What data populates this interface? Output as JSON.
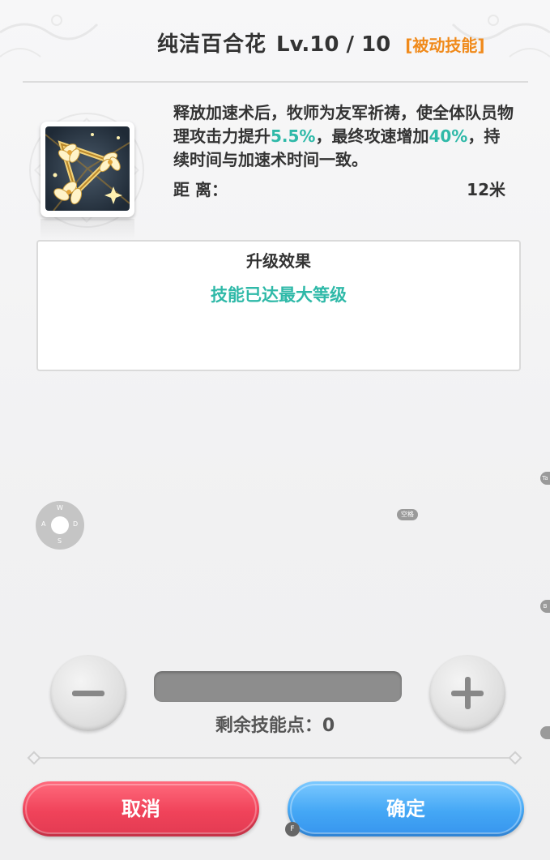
{
  "skill": {
    "name": "纯洁百合花",
    "level": "Lv.10 / 10",
    "type": "[被动技能]",
    "description_parts": {
      "p1": "释放加速术后，牧师为友军祈祷，使全体队员物理攻击力提升",
      "h1": "5.5%",
      "p2": "，最终攻速增加",
      "h2": "40%",
      "p3": "，持续时间与加速术时间一致。"
    },
    "range_label": "距 离：",
    "range_value": "12米",
    "icon": "lily-flowers-icon"
  },
  "upgrade": {
    "title": "升级效果",
    "message": "技能已达最大等级"
  },
  "overlay": {
    "wasd": {
      "w": "W",
      "a": "A",
      "s": "S",
      "d": "D"
    },
    "space_key": "空格",
    "tab_key": "Ta",
    "b_key": "B",
    "f_key": "F"
  },
  "controls": {
    "minus_icon": "minus-icon",
    "plus_icon": "plus-icon",
    "remaining_label": "剩余技能点：",
    "remaining_value": "0"
  },
  "actions": {
    "cancel_label": "取消",
    "confirm_label": "确定"
  },
  "colors": {
    "highlight": "#2fb9a8",
    "skill_type": "#f08a1b",
    "cancel": "#f0435a",
    "confirm": "#44a7f5"
  }
}
